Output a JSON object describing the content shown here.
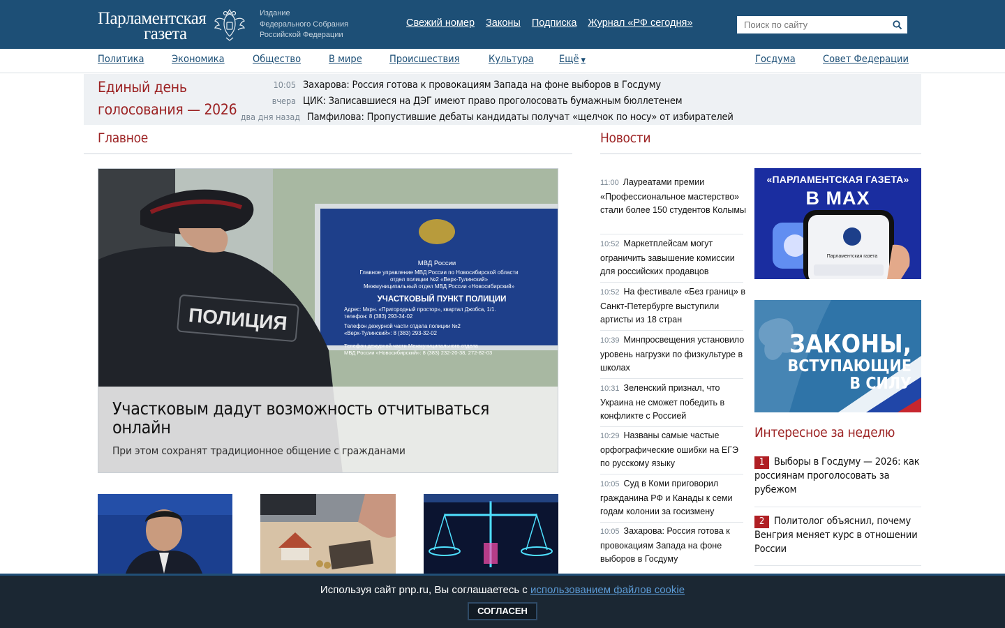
{
  "header": {
    "logo_line1": "Парламентская",
    "logo_line2": "газета",
    "publisher": [
      "Издание",
      "Федерального Собрания",
      "Российской Федерации"
    ],
    "nav": [
      "Свежий номер",
      "Законы",
      "Подписка",
      "Журнал «РФ сегодня»"
    ],
    "search_placeholder": "Поиск по сайту"
  },
  "rubrics": {
    "left": [
      "Политика",
      "Экономика",
      "Общество",
      "В мире",
      "Происшествия",
      "Культура",
      "Ещё"
    ],
    "right": [
      "Госдума",
      "Совет Федерации"
    ]
  },
  "special": {
    "title": "Единый день голосования — 2026",
    "items": [
      {
        "time": "10:05",
        "text": "Захарова: Россия готова к провокациям Запада на фоне выборов в Госдуму"
      },
      {
        "time": "вчера",
        "text": "ЦИК: Записавшиеся на ДЭГ имеют право проголосовать бумажным бюллетенем"
      },
      {
        "time": "два дня назад",
        "text": "Памфилова: Пропустившие дебаты кандидаты получат «щелчок по носу» от избирателей"
      }
    ]
  },
  "main": {
    "heading": "Главное",
    "feature_title": "Участковым дадут возможность отчитываться онлайн",
    "feature_lead": "При этом сохранят традиционное общение с гражданами",
    "photo_texts": {
      "patch": "ПОЛИЦИЯ",
      "sign_top": "МВД России",
      "sign_lines": [
        "Главное управление МВД России по Новосибирской области",
        "отдел полиции №2 «Верх-Тулинский»",
        "Межмуниципальный отдел МВД России «Новосибирский»"
      ],
      "sign_title": "УЧАСТКОВЫЙ ПУНКТ ПОЛИЦИИ",
      "sign_details": [
        "Адрес: Мкрн. «Пригородный простор», квартал Джобса, 1/1.",
        "телефон: 8 (383) 293-34-02",
        "Телефон дежурной части отдела полиции №2",
        "«Верх-Тулинский»: 8 (383) 293-32-02",
        "Телефон дежурной части Межмуниципального отдела",
        "МВД России «Новосибирский»: 8 (383) 232-20-38, 272-82-03"
      ]
    }
  },
  "news": {
    "heading": "Новости",
    "items": [
      {
        "time": "11:00",
        "text": "Лауреатами премии «Профессиональное мастерство» стали более 150 студентов Колымы"
      },
      {
        "time": "10:52",
        "text": "Маркетплейсам могут ограничить завышение комиссии для российских продавцов"
      },
      {
        "time": "10:52",
        "text": "На фестивале «Без границ» в Санкт-Петербурге выступили артисты из 18 стран"
      },
      {
        "time": "10:39",
        "text": "Минпросвещения установило уровень нагрузки по физкультуре в школах"
      },
      {
        "time": "10:31",
        "text": "Зеленский признал, что Украина не сможет победить в конфликте с Россией"
      },
      {
        "time": "10:29",
        "text": "Названы самые частые орфографические ошибки на ЕГЭ по русскому языку"
      },
      {
        "time": "10:05",
        "text": "Суд в Коми приговорил гражданина РФ и Канады к семи годам колонии за госизмену"
      },
      {
        "time": "10:05",
        "text": "Захарова: Россия готова к провокациям Запада на фоне выборов в Госдуму"
      }
    ]
  },
  "banners": {
    "max_title": "«ПАРЛАМЕНТСКАЯ ГАЗЕТА»",
    "max_big": "В MAX",
    "max_phone_caption": "Парламентская газета",
    "laws_line1": "ЗАКОНЫ,",
    "laws_line2": "ВСТУПАЮЩИЕ",
    "laws_line3": "В СИЛУ"
  },
  "weekly": {
    "heading": "Интересное за неделю",
    "items": [
      {
        "num": "1",
        "text": "Выборы в Госдуму — 2026: как россиянам проголосовать за рубежом"
      },
      {
        "num": "2",
        "text": "Политолог объяснил, почему Венгрия меняет курс в отношении России"
      }
    ]
  },
  "cookie": {
    "text": "Используя сайт pnp.ru, Вы соглашаетесь с ",
    "link": "использованием файлов cookie",
    "button": "СОГЛАСЕН"
  }
}
